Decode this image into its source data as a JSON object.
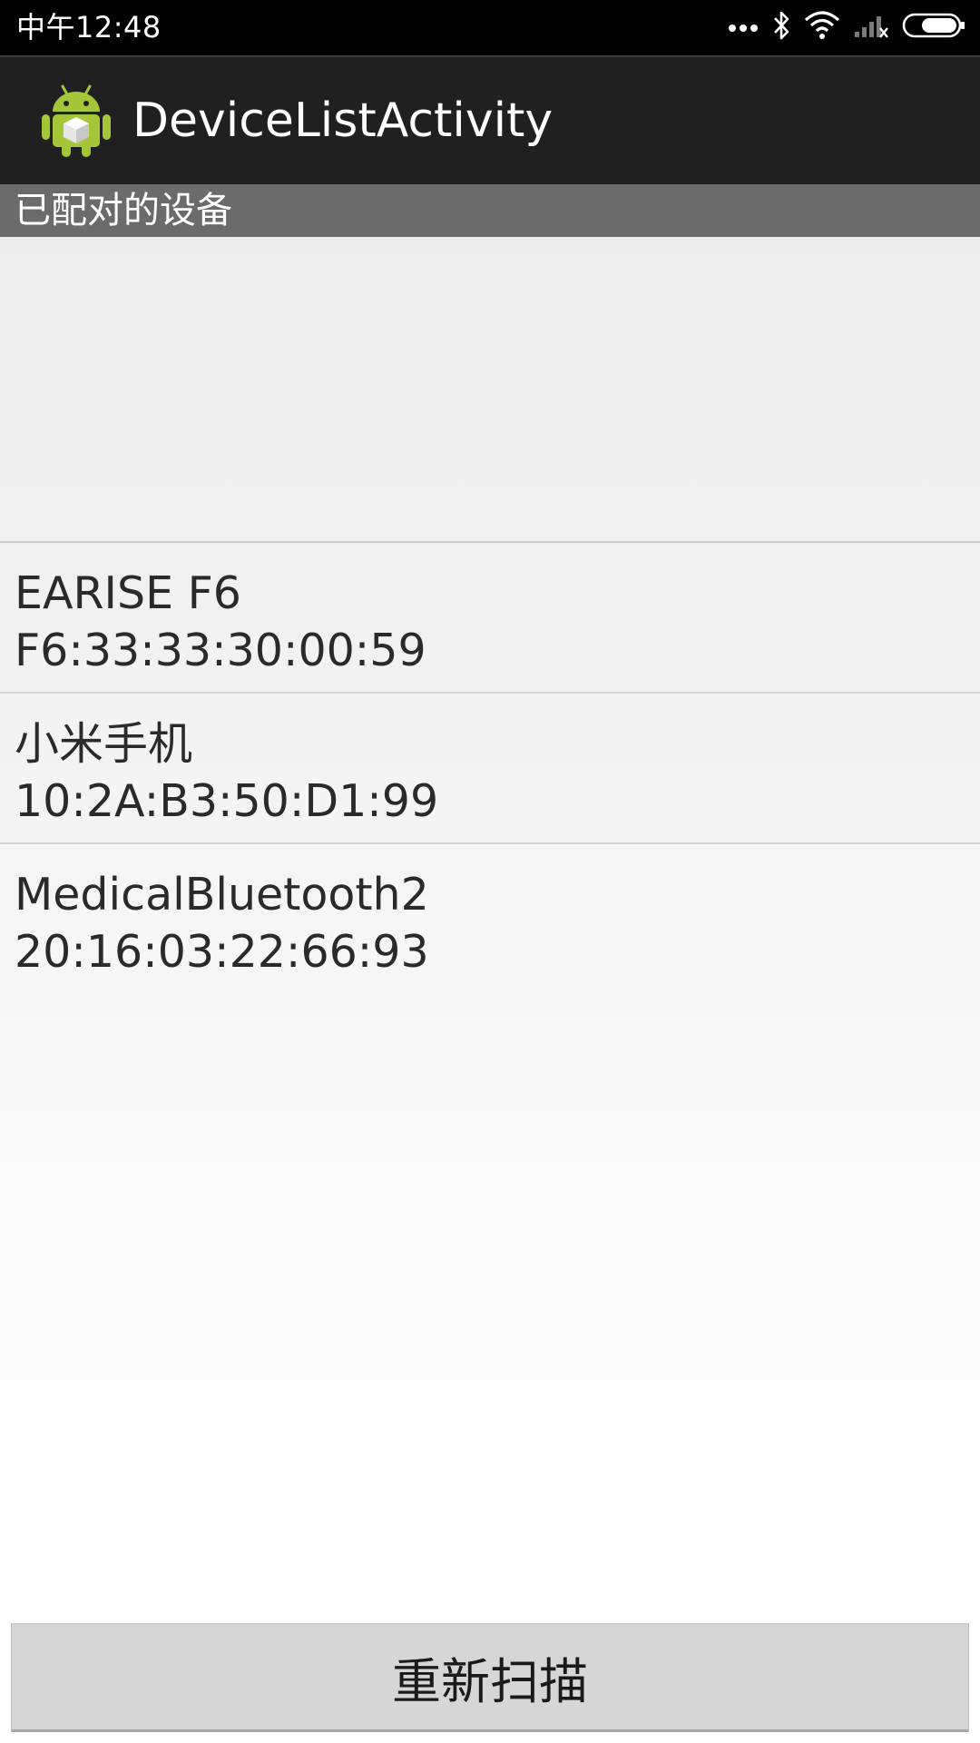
{
  "status_bar": {
    "time": "中午12:48",
    "icons": [
      "more-dots-icon",
      "bluetooth-icon",
      "wifi-icon",
      "signal-no-service-icon",
      "battery-icon"
    ]
  },
  "action_bar": {
    "app_icon": "android-app-icon",
    "title": "DeviceListActivity"
  },
  "paired_section": {
    "header": "已配对的设备",
    "items": []
  },
  "devices": [
    {
      "name": "EARISE F6",
      "address": "F6:33:33:30:00:59"
    },
    {
      "name": "小米手机",
      "address": "10:2A:B3:50:D1:99"
    },
    {
      "name": "MedicalBluetooth2",
      "address": "20:16:03:22:66:93"
    }
  ],
  "rescan_button": {
    "label": "重新扫描"
  },
  "colors": {
    "status_bar_bg": "#000000",
    "action_bar_bg": "#202020",
    "section_header_bg": "#6b6b6b",
    "button_bg": "#d6d6d6",
    "android_green": "#a4c639"
  }
}
